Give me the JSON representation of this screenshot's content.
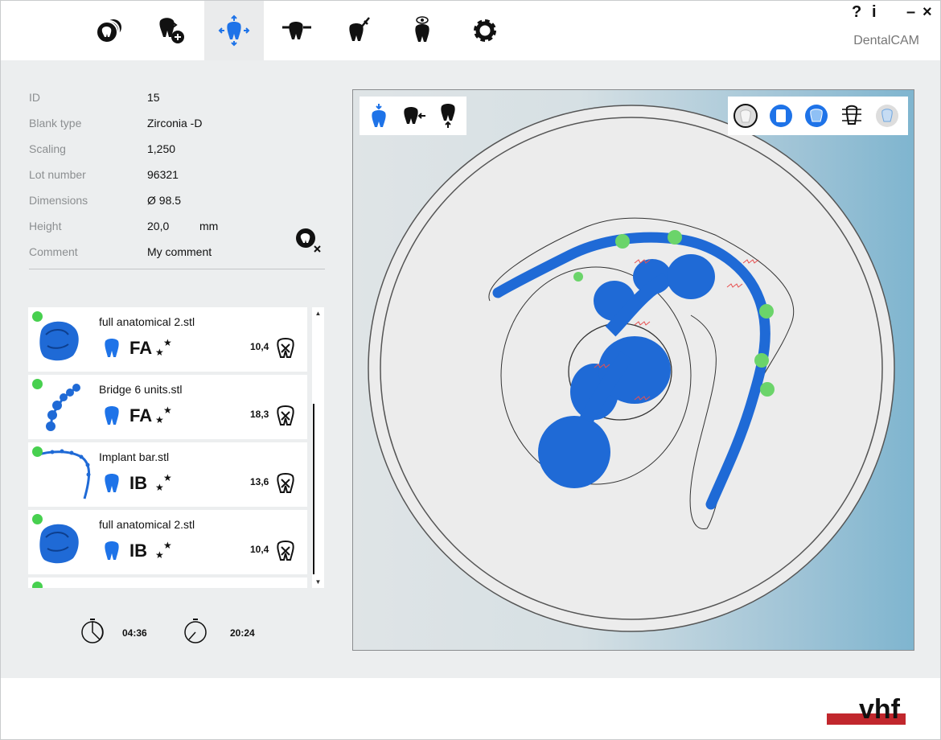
{
  "app": {
    "brand": "DentalCAM"
  },
  "window_controls": {
    "help": "?",
    "info": "i",
    "minimize": "–",
    "close": "×"
  },
  "toolbar": {
    "tools": [
      {
        "name": "blank-tool",
        "icon": "blank-disc-icon"
      },
      {
        "name": "import-tool",
        "icon": "tooth-import-icon"
      },
      {
        "name": "position-tool",
        "icon": "tooth-move-icon",
        "active": true
      },
      {
        "name": "connectors-tool",
        "icon": "tooth-connectors-icon"
      },
      {
        "name": "calculate-tool",
        "icon": "tooth-tool-icon"
      },
      {
        "name": "preview-tool",
        "icon": "tooth-eye-icon"
      },
      {
        "name": "settings-tool",
        "icon": "gear-icon"
      }
    ]
  },
  "blank_info": {
    "rows": [
      {
        "label": "ID",
        "value": "15"
      },
      {
        "label": "Blank type",
        "value": "Zirconia -D"
      },
      {
        "label": "Scaling",
        "value": "1,250"
      },
      {
        "label": "Lot number",
        "value": "96321"
      },
      {
        "label": "Dimensions",
        "value": "Ø 98.5"
      },
      {
        "label": "Height",
        "value": "20,0",
        "unit": "mm"
      },
      {
        "label": "Comment",
        "value": "My comment"
      }
    ]
  },
  "jobs": [
    {
      "file": "full anatomical 2.stl",
      "code": "FA",
      "value": "10,4",
      "status": "ok"
    },
    {
      "file": "Bridge 6 units.stl",
      "code": "FA",
      "value": "18,3",
      "status": "ok"
    },
    {
      "file": "Implant bar.stl",
      "code": "IB",
      "value": "13,6",
      "status": "ok"
    },
    {
      "file": "full anatomical 2.stl",
      "code": "IB",
      "value": "10,4",
      "status": "ok"
    }
  ],
  "times": {
    "milling": "04:36",
    "total": "20:24"
  },
  "colors": {
    "accent": "#1e73e8",
    "status_ok": "#47d04f",
    "model": "#1f6ad6",
    "brand_red": "#c1272d"
  }
}
